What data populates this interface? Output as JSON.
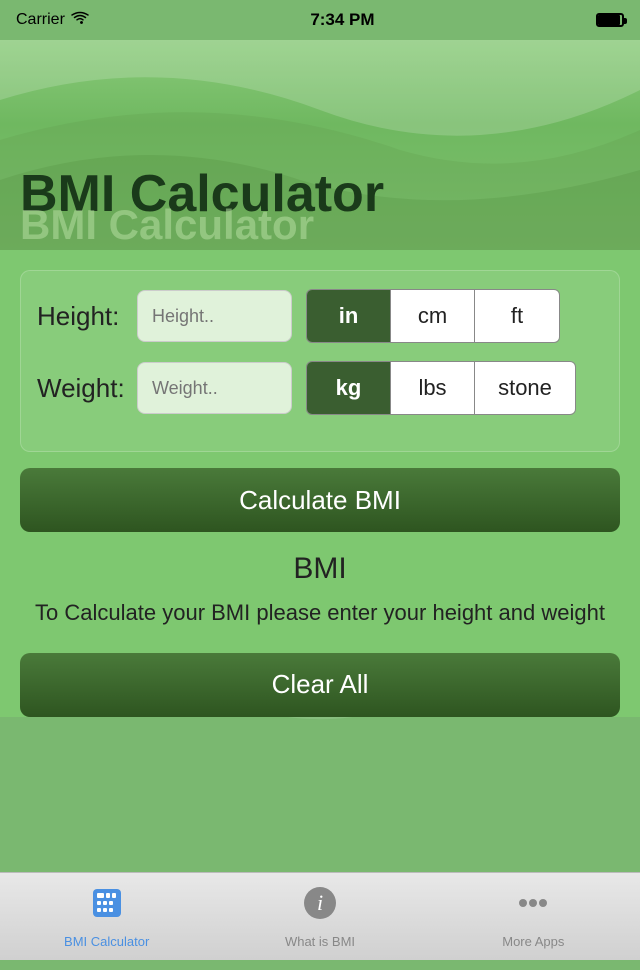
{
  "statusBar": {
    "carrier": "Carrier",
    "time": "7:34 PM"
  },
  "header": {
    "title": "BMI Calculator",
    "subtitle": "BMI Calculator"
  },
  "heightRow": {
    "label": "Height:",
    "placeholder": "Height..",
    "units": [
      "in",
      "cm",
      "ft"
    ],
    "activeUnit": "in"
  },
  "weightRow": {
    "label": "Weight:",
    "placeholder": "Weight..",
    "units": [
      "kg",
      "lbs",
      "stone"
    ],
    "activeUnit": "kg"
  },
  "buttons": {
    "calculate": "Calculate BMI",
    "clearAll": "Clear All"
  },
  "result": {
    "label": "BMI",
    "description": "To Calculate your BMI please enter your height and weight"
  },
  "tabBar": {
    "tabs": [
      {
        "id": "bmi-calculator",
        "label": "BMI Calculator",
        "active": true
      },
      {
        "id": "what-is-bmi",
        "label": "What is BMI",
        "active": false
      },
      {
        "id": "more-apps",
        "label": "More Apps",
        "active": false
      }
    ]
  }
}
